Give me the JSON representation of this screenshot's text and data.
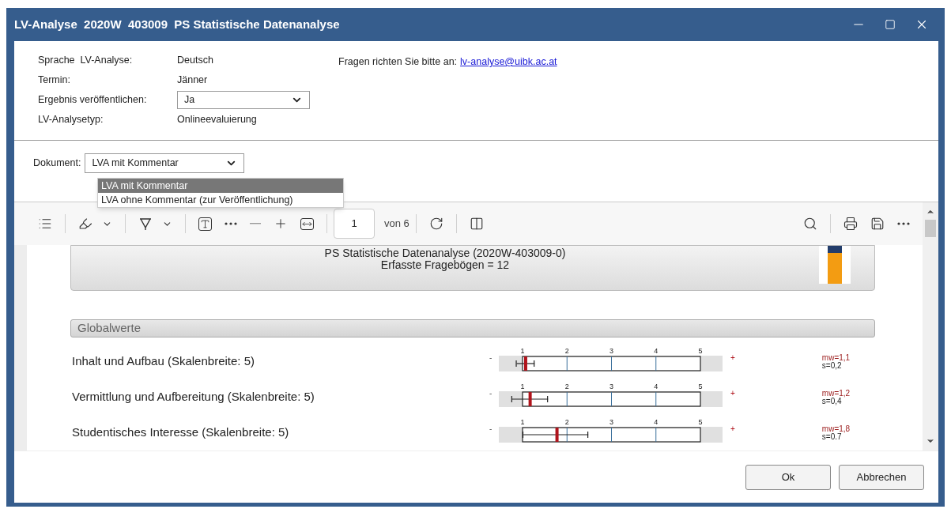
{
  "window": {
    "title": "LV-Analyse  2020W  403009  PS Statistische Datenanalyse"
  },
  "info": {
    "fields": [
      {
        "kind": "text",
        "label": "Sprache  LV-Analyse:",
        "value": "Deutsch"
      },
      {
        "kind": "text",
        "label": "Termin:",
        "value": "Jänner"
      },
      {
        "kind": "select",
        "label": "Ergebnis veröffentlichen:",
        "value": "Ja"
      },
      {
        "kind": "text",
        "label": "LV-Analysetyp:",
        "value": "Onlineevaluierung"
      }
    ],
    "contact": {
      "label": "Fragen richten Sie bitte an:",
      "link": "lv-analyse@uibk.ac.at"
    }
  },
  "document": {
    "label": "Dokument:",
    "value": "LVA mit Kommentar",
    "expanded": true,
    "options": [
      {
        "label": "LVA mit Kommentar",
        "selected": true
      },
      {
        "label": "LVA ohne Kommentar (zur Veröffentlichung)",
        "selected": false
      }
    ]
  },
  "toolbar": {
    "page": "1",
    "page_count": "von 6"
  },
  "report": {
    "title": "PS Statistische Datenanalyse (2020W-403009-0)",
    "subtitle": "Erfasste Fragebögen = 12",
    "section": "Globalwerte",
    "rows": [
      {
        "label": "Inhalt und Aufbau (Skalenbreite: 5)",
        "minus": "-",
        "plus": "+",
        "mean_text": "mw=1,1",
        "sd_text": "s=0,2",
        "scale": {
          "ticks": [
            "1",
            "2",
            "3",
            "4",
            "5"
          ],
          "mean": {
            "level": 0.12
          },
          "whisker_low": {
            "level": 0.08
          },
          "whisker_high": {
            "level": 0.16
          }
        }
      },
      {
        "label": "Vermittlung und Aufbereitung (Skalenbreite: 5)",
        "minus": "-",
        "plus": "+",
        "mean_text": "mw=1,2",
        "sd_text": "s=0,4",
        "scale": {
          "ticks": [
            "1",
            "2",
            "3",
            "4",
            "5"
          ],
          "mean": {
            "level": 0.14
          },
          "whisker_low": {
            "level": 0.06
          },
          "whisker_high": {
            "level": 0.22
          }
        }
      },
      {
        "label": "Studentisches Interesse (Skalenbreite: 5)",
        "minus": "-",
        "plus": "+",
        "mean_text": "mw=1,8",
        "sd_text": "s=0.7",
        "scale": {
          "ticks": [
            "1",
            "2",
            "3",
            "4",
            "5"
          ],
          "mean": {
            "level": 0.26
          },
          "whisker_low": {
            "level": 0.11
          },
          "whisker_high": {
            "level": 0.4
          }
        }
      }
    ]
  },
  "buttons": [
    "Ok",
    "Abbrechen"
  ]
}
